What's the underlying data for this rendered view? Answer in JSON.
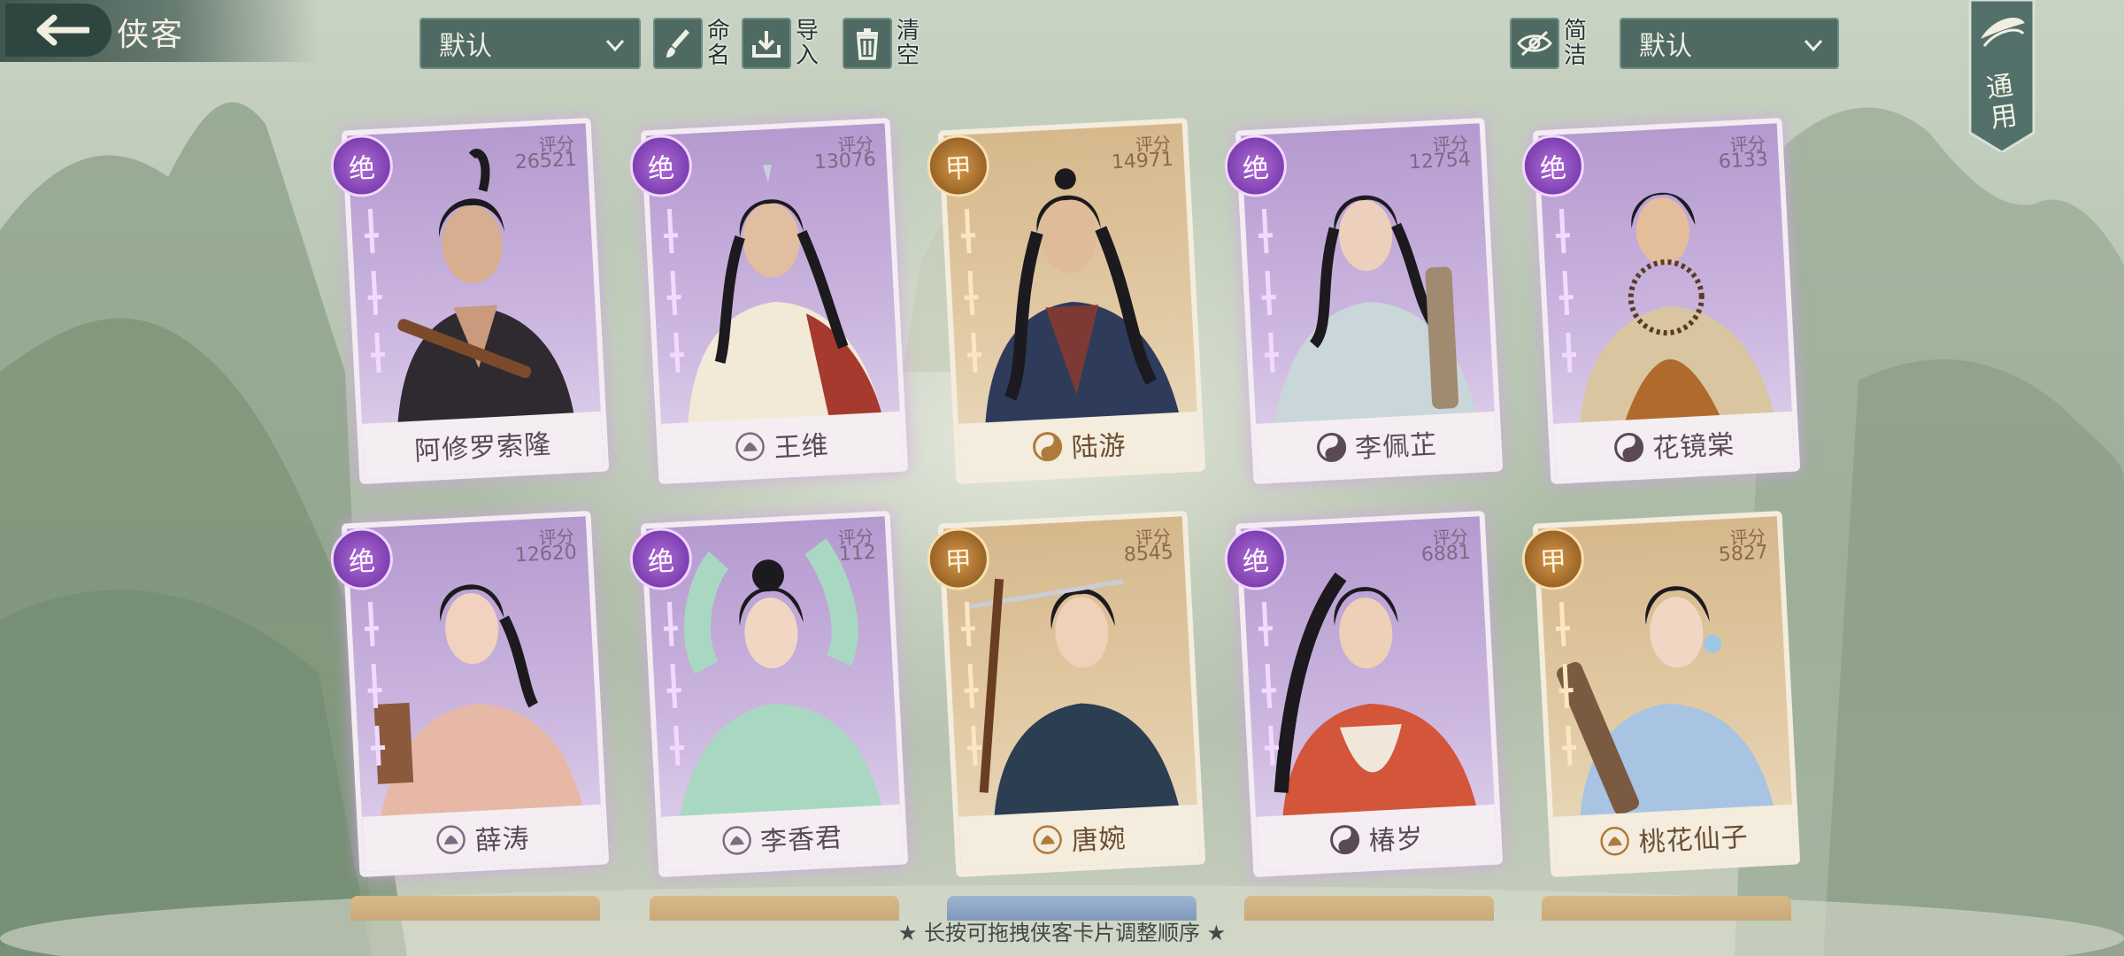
{
  "header": {
    "title": "侠客",
    "sort_select": "默认",
    "tools": [
      {
        "label": "命名",
        "icon": "brush-icon"
      },
      {
        "label": "导入",
        "icon": "import-icon"
      },
      {
        "label": "清空",
        "icon": "trash-icon"
      }
    ],
    "simple_toggle": {
      "label": "简洁",
      "icon": "eye-slash-icon"
    },
    "filter_select": "默认",
    "ribbon_label": "通用"
  },
  "cards": [
    {
      "name": "阿修罗索隆",
      "rank": "绝",
      "score_label": "评分",
      "score": "26521",
      "tier": "purple",
      "faction_icon": "none"
    },
    {
      "name": "王维",
      "rank": "绝",
      "score_label": "评分",
      "score": "13076",
      "tier": "purple",
      "faction_icon": "lotus-icon"
    },
    {
      "name": "陆游",
      "rank": "甲",
      "score_label": "评分",
      "score": "14971",
      "tier": "gold",
      "faction_icon": "yin-yang-icon"
    },
    {
      "name": "李佩芷",
      "rank": "绝",
      "score_label": "评分",
      "score": "12754",
      "tier": "purple",
      "faction_icon": "yin-yang-icon"
    },
    {
      "name": "花镜棠",
      "rank": "绝",
      "score_label": "评分",
      "score": "6133",
      "tier": "purple",
      "faction_icon": "yin-yang-icon"
    },
    {
      "name": "薛涛",
      "rank": "绝",
      "score_label": "评分",
      "score": "12620",
      "tier": "purple",
      "faction_icon": "lotus-icon"
    },
    {
      "name": "李香君",
      "rank": "绝",
      "score_label": "评分",
      "score": "112",
      "tier": "purple",
      "faction_icon": "lotus-icon"
    },
    {
      "name": "唐婉",
      "rank": "甲",
      "score_label": "评分",
      "score": "8545",
      "tier": "gold",
      "faction_icon": "lotus-icon"
    },
    {
      "name": "椿岁",
      "rank": "绝",
      "score_label": "评分",
      "score": "6881",
      "tier": "purple",
      "faction_icon": "yin-yang-icon"
    },
    {
      "name": "桃花仙子",
      "rank": "甲",
      "score_label": "评分",
      "score": "5827",
      "tier": "gold",
      "faction_icon": "lotus-icon"
    }
  ],
  "footer_tip": "★ 长按可拖拽侠客卡片调整顺序 ★",
  "colors": {
    "accent": "#4e6a62",
    "purple_rank": "#7d3fb0",
    "gold_rank": "#9b6426"
  }
}
